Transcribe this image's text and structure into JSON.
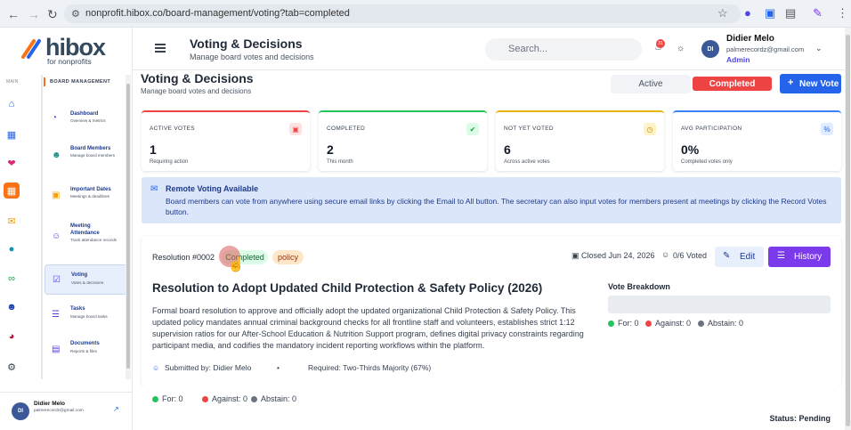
{
  "browser": {
    "url": "nonprofit.hibox.co/board-management/voting?tab=completed"
  },
  "logo": {
    "name": "hibox",
    "tagline": "for nonprofits"
  },
  "rail": {
    "label": "MAIN"
  },
  "sidebar": {
    "section": "BOARD MANAGEMENT",
    "items": [
      {
        "title": "Dashboard",
        "sub": "Overview & metrics"
      },
      {
        "title": "Board Members",
        "sub": "Manage board members"
      },
      {
        "title": "Important Dates",
        "sub": "Meetings & deadlines"
      },
      {
        "title": "Meeting Attendance",
        "sub": "Track attendance records"
      },
      {
        "title": "Voting",
        "sub": "Votes & decisions"
      },
      {
        "title": "Tasks",
        "sub": "Manage board tasks"
      },
      {
        "title": "Documents",
        "sub": "Reports & files"
      }
    ],
    "user": {
      "initials": "DI",
      "name": "Didier Melo",
      "email": "palmerecordz@gmail.com"
    }
  },
  "header": {
    "title": "Voting & Decisions",
    "subtitle": "Manage board votes and decisions",
    "search_placeholder": "Search...",
    "notif_count": "31",
    "user": {
      "initials": "DI",
      "name": "Didier Melo",
      "email": "palmerecordz@gmail.com",
      "role": "Admin"
    }
  },
  "page": {
    "title": "Voting & Decisions",
    "subtitle": "Manage board votes and decisions",
    "tabs": {
      "active": "Active",
      "completed": "Completed"
    },
    "new_vote": "New Vote"
  },
  "stats": [
    {
      "label": "ACTIVE VOTES",
      "value": "1",
      "sub": "Requiring action",
      "color": "#ef4444"
    },
    {
      "label": "COMPLETED",
      "value": "2",
      "sub": "This month",
      "color": "#22c55e"
    },
    {
      "label": "NOT YET VOTED",
      "value": "6",
      "sub": "Across active votes",
      "color": "#eab308"
    },
    {
      "label": "AVG PARTICIPATION",
      "value": "0%",
      "sub": "Completed votes only",
      "color": "#3b82f6"
    }
  ],
  "banner": {
    "title": "Remote Voting Available",
    "body": "Board members can vote from anywhere using secure email links by clicking the Email to All button. The secretary can also input votes for members present at meetings by clicking the Record Votes button."
  },
  "resolution": {
    "id": "Resolution #0002",
    "status_badge": "Completed",
    "category_badge": "policy",
    "closed": "Closed Jun 24, 2026",
    "voted": "0/6 Voted",
    "edit": "Edit",
    "history": "History",
    "title": "Resolution to Adopt Updated Child Protection & Safety Policy (2026)",
    "description": "Formal board resolution to approve and officially adopt the updated organizational Child Protection & Safety Policy. This updated policy mandates annual criminal background checks for all frontline staff and volunteers, establishes strict 1:12 supervision ratios for our After-School Education & Nutrition Support program, defines digital privacy constraints regarding participant media, and codifies the mandatory incident reporting workflows within the platform.",
    "submitted_by": "Submitted by: Didier Melo",
    "required": "Required: Two-Thirds Majority (67%)",
    "breakdown_title": "Vote Breakdown",
    "for": "For: 0",
    "against": "Against: 0",
    "abstain": "Abstain: 0",
    "status": "Status: Pending"
  },
  "colors": {
    "for": "#22c55e",
    "against": "#ef4444",
    "abstain": "#6b7280",
    "accent": "#4f46e5",
    "completed": "#ef4444"
  }
}
